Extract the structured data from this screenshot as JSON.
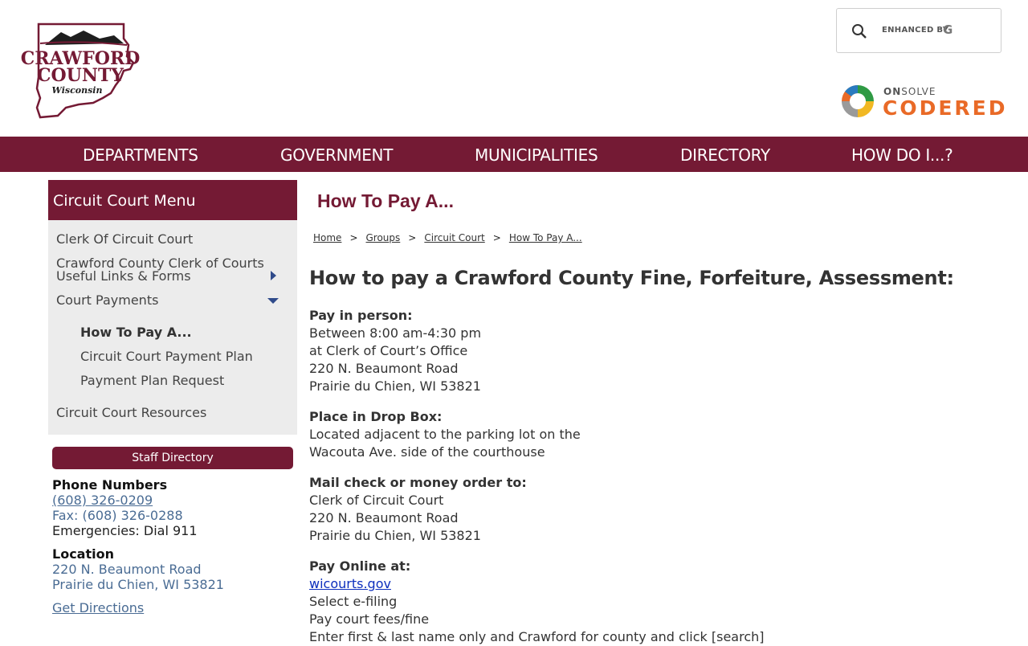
{
  "logo": {
    "line1": "CRAWFORD",
    "line2": "COUNTY",
    "line3": "Wisconsin"
  },
  "search": {
    "enhanced_label": "ENHANCED BY",
    "brand_letter": "G"
  },
  "codered": {
    "onsolve_on": "ON",
    "onsolve_solve": "SOLVE",
    "name": "CODERED"
  },
  "nav": [
    {
      "label": "DEPARTMENTS"
    },
    {
      "label": "GOVERNMENT"
    },
    {
      "label": "MUNICIPALITIES"
    },
    {
      "label": "DIRECTORY"
    },
    {
      "label": "HOW DO I...?"
    }
  ],
  "sidebar": {
    "menu_title": "Circuit Court Menu",
    "items": [
      {
        "label": "Clerk Of Circuit Court"
      },
      {
        "label_line1": "Crawford County Clerk of Courts",
        "label_line2": "Useful Links & Forms"
      },
      {
        "label": "Court Payments"
      },
      {
        "label": "Circuit Court Resources"
      }
    ],
    "sub_items": [
      {
        "label": "How To Pay A..."
      },
      {
        "label": "Circuit Court Payment Plan"
      },
      {
        "label": "Payment Plan Request"
      }
    ],
    "staff_directory": "Staff Directory",
    "phone_heading": "Phone Numbers",
    "phone": "(608) 326-0209",
    "fax": "Fax: (608) 326-0288",
    "emergencies": "Emergencies: Dial 911",
    "location_heading": "Location",
    "address1": "220 N. Beaumont Road",
    "address2": "Prairie du Chien, WI 53821",
    "directions": "Get Directions"
  },
  "main": {
    "title": "How To Pay A...",
    "breadcrumb": [
      "Home",
      "Groups",
      "Circuit Court",
      "How To Pay A..."
    ],
    "heading": "How to pay a Crawford County Fine, Forfeiture, Assessment:",
    "sections": [
      {
        "title": "Pay in person:",
        "lines": [
          "Between 8:00 am-4:30 pm",
          "at Clerk of Court’s Office",
          "220 N. Beaumont Road",
          "Prairie du Chien, WI  53821"
        ]
      },
      {
        "title": "Place in Drop Box:",
        "lines": [
          "Located adjacent to the parking lot on the",
          "Wacouta Ave. side of the courthouse"
        ]
      },
      {
        "title": "Mail check or money order to:",
        "lines": [
          "Clerk of Circuit Court",
          "220 N. Beaumont Road",
          "Prairie du Chien, WI  53821"
        ]
      },
      {
        "title": "Pay Online at:",
        "link": "wicourts.gov",
        "lines": [
          "Select e-filing",
          "Pay court fees/fine",
          "Enter first & last name only and Crawford for county and click [search]"
        ]
      }
    ]
  },
  "colors": {
    "brand": "#741a34",
    "link": "#0d2fbd",
    "contact_link": "#4a6c94",
    "codered_orange": "#e96a27"
  }
}
